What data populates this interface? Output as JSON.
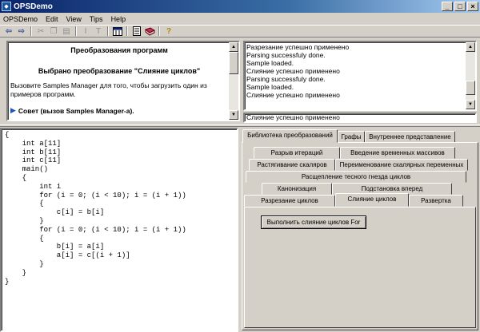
{
  "window": {
    "title": "OPSDemo",
    "controls": [
      "_",
      "□",
      "×"
    ]
  },
  "menu": [
    "OPSDemo",
    "Edit",
    "View",
    "Tips",
    "Help"
  ],
  "toolbar": {
    "icons": [
      "back-arrow-icon",
      "forward-arrow-icon",
      "cut-icon",
      "copy-icon",
      "paste-icon",
      "text-cursor-icon",
      "text-format-icon",
      "calendar-icon",
      "list-icon",
      "book-icon",
      "help-icon"
    ]
  },
  "info": {
    "title": "Преобразования программ",
    "subtitle": "Выбрано преобразование \"Слияние циклов\"",
    "text": "Вызовите Samples Manager для того, чтобы загрузить один из примеров программ.",
    "tip": "Совет (вызов Samples Manager-а)."
  },
  "log": {
    "lines": [
      "Разрезание успешно применено",
      "Parsing successfuly done.",
      "Sample loaded.",
      "Слияние успешно применено",
      "Parsing successfuly done.",
      "Sample loaded.",
      "Слияние успешно применено"
    ],
    "status": "Слияние успешно применено"
  },
  "code": "{\n    int a[11]\n    int b[11]\n    int c[11]\n    main()\n    {\n        int i\n        for (i = 0; (i < 10); i = (i + 1))\n        {\n            c[i] = b[i]\n        }\n        for (i = 0; (i < 10); i = (i + 1))\n        {\n            b[i] = a[i]\n            a[i] = c[(i + 1)]\n        }\n    }\n}",
  "tabs": {
    "top": [
      "Библиотека преобразований",
      "Графы",
      "Внутреннее представление"
    ],
    "row1": [
      "Разрыв итераций",
      "Введение временных массивов"
    ],
    "row2": [
      "Растягивание скаляров",
      "Переименование скалярных переменных"
    ],
    "row3": [
      "Расщепление тесного гнезда циклов"
    ],
    "row4": [
      "Канонизация",
      "Подстановка вперед"
    ],
    "row5": [
      "Разрезание циклов",
      "Слияние циклов",
      "Развертка"
    ]
  },
  "action_button": "Выполнить слияние циклов For"
}
